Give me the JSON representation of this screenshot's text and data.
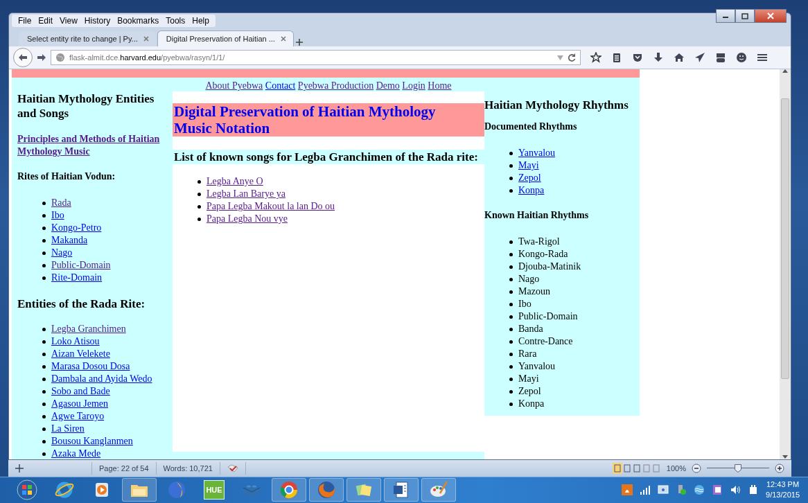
{
  "menu": [
    "File",
    "Edit",
    "View",
    "History",
    "Bookmarks",
    "Tools",
    "Help"
  ],
  "tabs": [
    {
      "label": "Select entity rite to change | Py...",
      "selected": false
    },
    {
      "label": "Digital Preservation of Haitian ...",
      "selected": true
    }
  ],
  "address": "flask-almit.dce.**harvard.edu**/pyebwa/rasyn/1/1/",
  "nav": [
    {
      "label": "About Pyebwa",
      "visited": true
    },
    {
      "label": "Contact",
      "visited": false
    },
    {
      "label": "Pyebwa Production",
      "visited": true
    },
    {
      "label": "Demo",
      "visited": true
    },
    {
      "label": "Login",
      "visited": true
    },
    {
      "label": "Home",
      "visited": true
    }
  ],
  "left": {
    "heading": "Haitian Mythology Entities and Songs",
    "principles_link": {
      "label": "Principles and Methods of Haitian Mythology Music",
      "visited": true
    },
    "rites_heading": "Rites of Haitian Vodun:",
    "rites": [
      {
        "label": "Rada",
        "visited": true
      },
      {
        "label": "Ibo",
        "visited": false
      },
      {
        "label": "Kongo-Petro",
        "visited": false
      },
      {
        "label": "Makanda",
        "visited": false
      },
      {
        "label": "Nago",
        "visited": false
      },
      {
        "label": "Public-Domain",
        "visited": true
      },
      {
        "label": "Rite-Domain",
        "visited": false
      }
    ],
    "entities_heading": "Entities of the Rada Rite:",
    "entities": [
      {
        "label": "Legba Granchimen",
        "visited": true
      },
      {
        "label": "Loko Atisou",
        "visited": false
      },
      {
        "label": "Aizan Velekete",
        "visited": false
      },
      {
        "label": "Marasa Dosou Dosa",
        "visited": false
      },
      {
        "label": "Dambala and Ayida Wedo",
        "visited": false
      },
      {
        "label": "Sobo and Bade",
        "visited": false
      },
      {
        "label": "Agasou Jemen",
        "visited": false
      },
      {
        "label": "Agwe Taroyo",
        "visited": false
      },
      {
        "label": "La Siren",
        "visited": false
      },
      {
        "label": "Bousou Kanglanmen",
        "visited": false
      },
      {
        "label": "Azaka Mede",
        "visited": false
      }
    ]
  },
  "main": {
    "title": "Digital Preservation of Haitian Mythology Music Notation",
    "songs_heading": "List of known songs for Legba Granchimen of the Rada rite:",
    "songs": [
      {
        "label": "Legba Anye O",
        "visited": true
      },
      {
        "label": "Legba Lan Barye ya",
        "visited": true
      },
      {
        "label": "Papa Legba Makout la lan Do ou",
        "visited": true
      },
      {
        "label": "Papa Legba Nou vye",
        "visited": true
      }
    ]
  },
  "right": {
    "heading": "Haitian Mythology Rhythms",
    "documented_heading": "Documented Rhythms",
    "documented": [
      {
        "label": "Yanvalou",
        "visited": false
      },
      {
        "label": "Mayi",
        "visited": false
      },
      {
        "label": "Zepol",
        "visited": false
      },
      {
        "label": "Konpa",
        "visited": false
      }
    ],
    "known_heading": "Known Haitian Rhythms",
    "known": [
      "Twa-Rigol",
      "Kongo-Rada",
      "Djouba-Matinik",
      "Nago",
      "Mazoun",
      "Ibo",
      "Public-Domain",
      "Banda",
      "Contre-Dance",
      "Rara",
      "Yanvalou",
      "Mayi",
      "Zepol",
      "Konpa"
    ]
  },
  "word_status": {
    "page": "Page: 22 of 54",
    "words": "Words: 10,721",
    "zoom": "100%",
    "zoom_slider": {
      "level": 0.5
    }
  },
  "taskbar": {
    "hue_label": "HUE",
    "time": "12:43 PM",
    "date": "9/13/2015"
  }
}
